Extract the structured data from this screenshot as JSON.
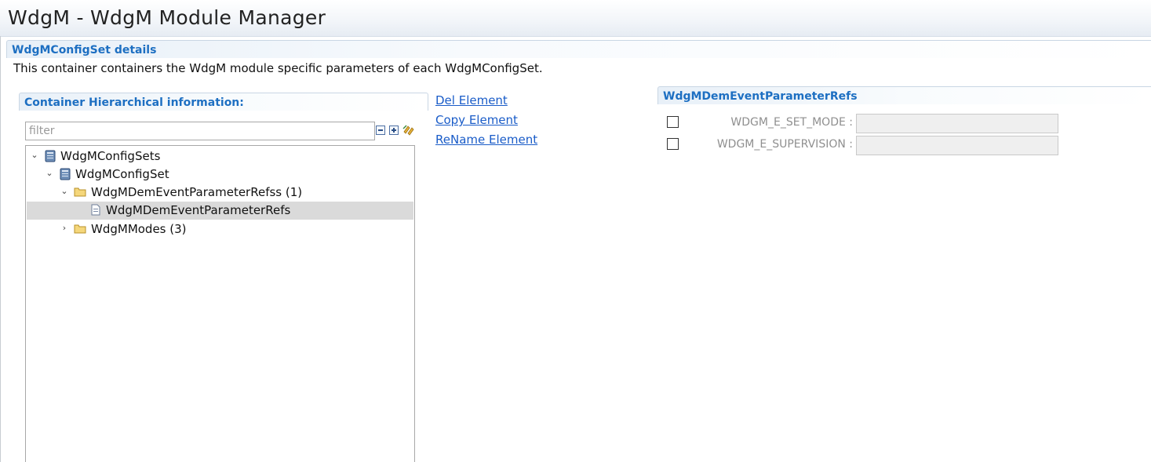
{
  "window": {
    "title": "WdgM - WdgM Module Manager"
  },
  "section": {
    "title": "WdgMConfigSet details",
    "description": "This container containers the WdgM module specific parameters of each WdgMConfigSet."
  },
  "hierarchy": {
    "title": "Container Hierarchical information:",
    "filter_placeholder": "filter",
    "filter_value": "",
    "tools": [
      "collapse-all-icon",
      "expand-all-icon",
      "sync-icon"
    ],
    "tree": [
      {
        "label": "WdgMConfigSets",
        "icon": "config-container-icon",
        "expanded": true,
        "selected": false
      },
      {
        "label": "WdgMConfigSet",
        "icon": "config-container-icon",
        "expanded": true,
        "selected": false
      },
      {
        "label": "WdgMDemEventParameterRefss (1)",
        "icon": "folder-icon",
        "expanded": true,
        "selected": false
      },
      {
        "label": "WdgMDemEventParameterRefs",
        "icon": "document-icon",
        "expanded": false,
        "selected": true
      },
      {
        "label": "WdgMModes (3)",
        "icon": "folder-icon",
        "expanded": false,
        "selected": false
      }
    ]
  },
  "actions": {
    "del": "Del Element",
    "copy": "Copy Element",
    "rename": "ReName Element"
  },
  "dem": {
    "title": "WdgMDemEventParameterRefs",
    "params": [
      {
        "label": "WDGM_E_SET_MODE :",
        "checked": false,
        "value": ""
      },
      {
        "label": "WDGM_E_SUPERVISION :",
        "checked": false,
        "value": ""
      }
    ]
  },
  "colors": {
    "accent": "#1d6fc2",
    "link": "#1a5cc8",
    "selection": "#dadada"
  }
}
